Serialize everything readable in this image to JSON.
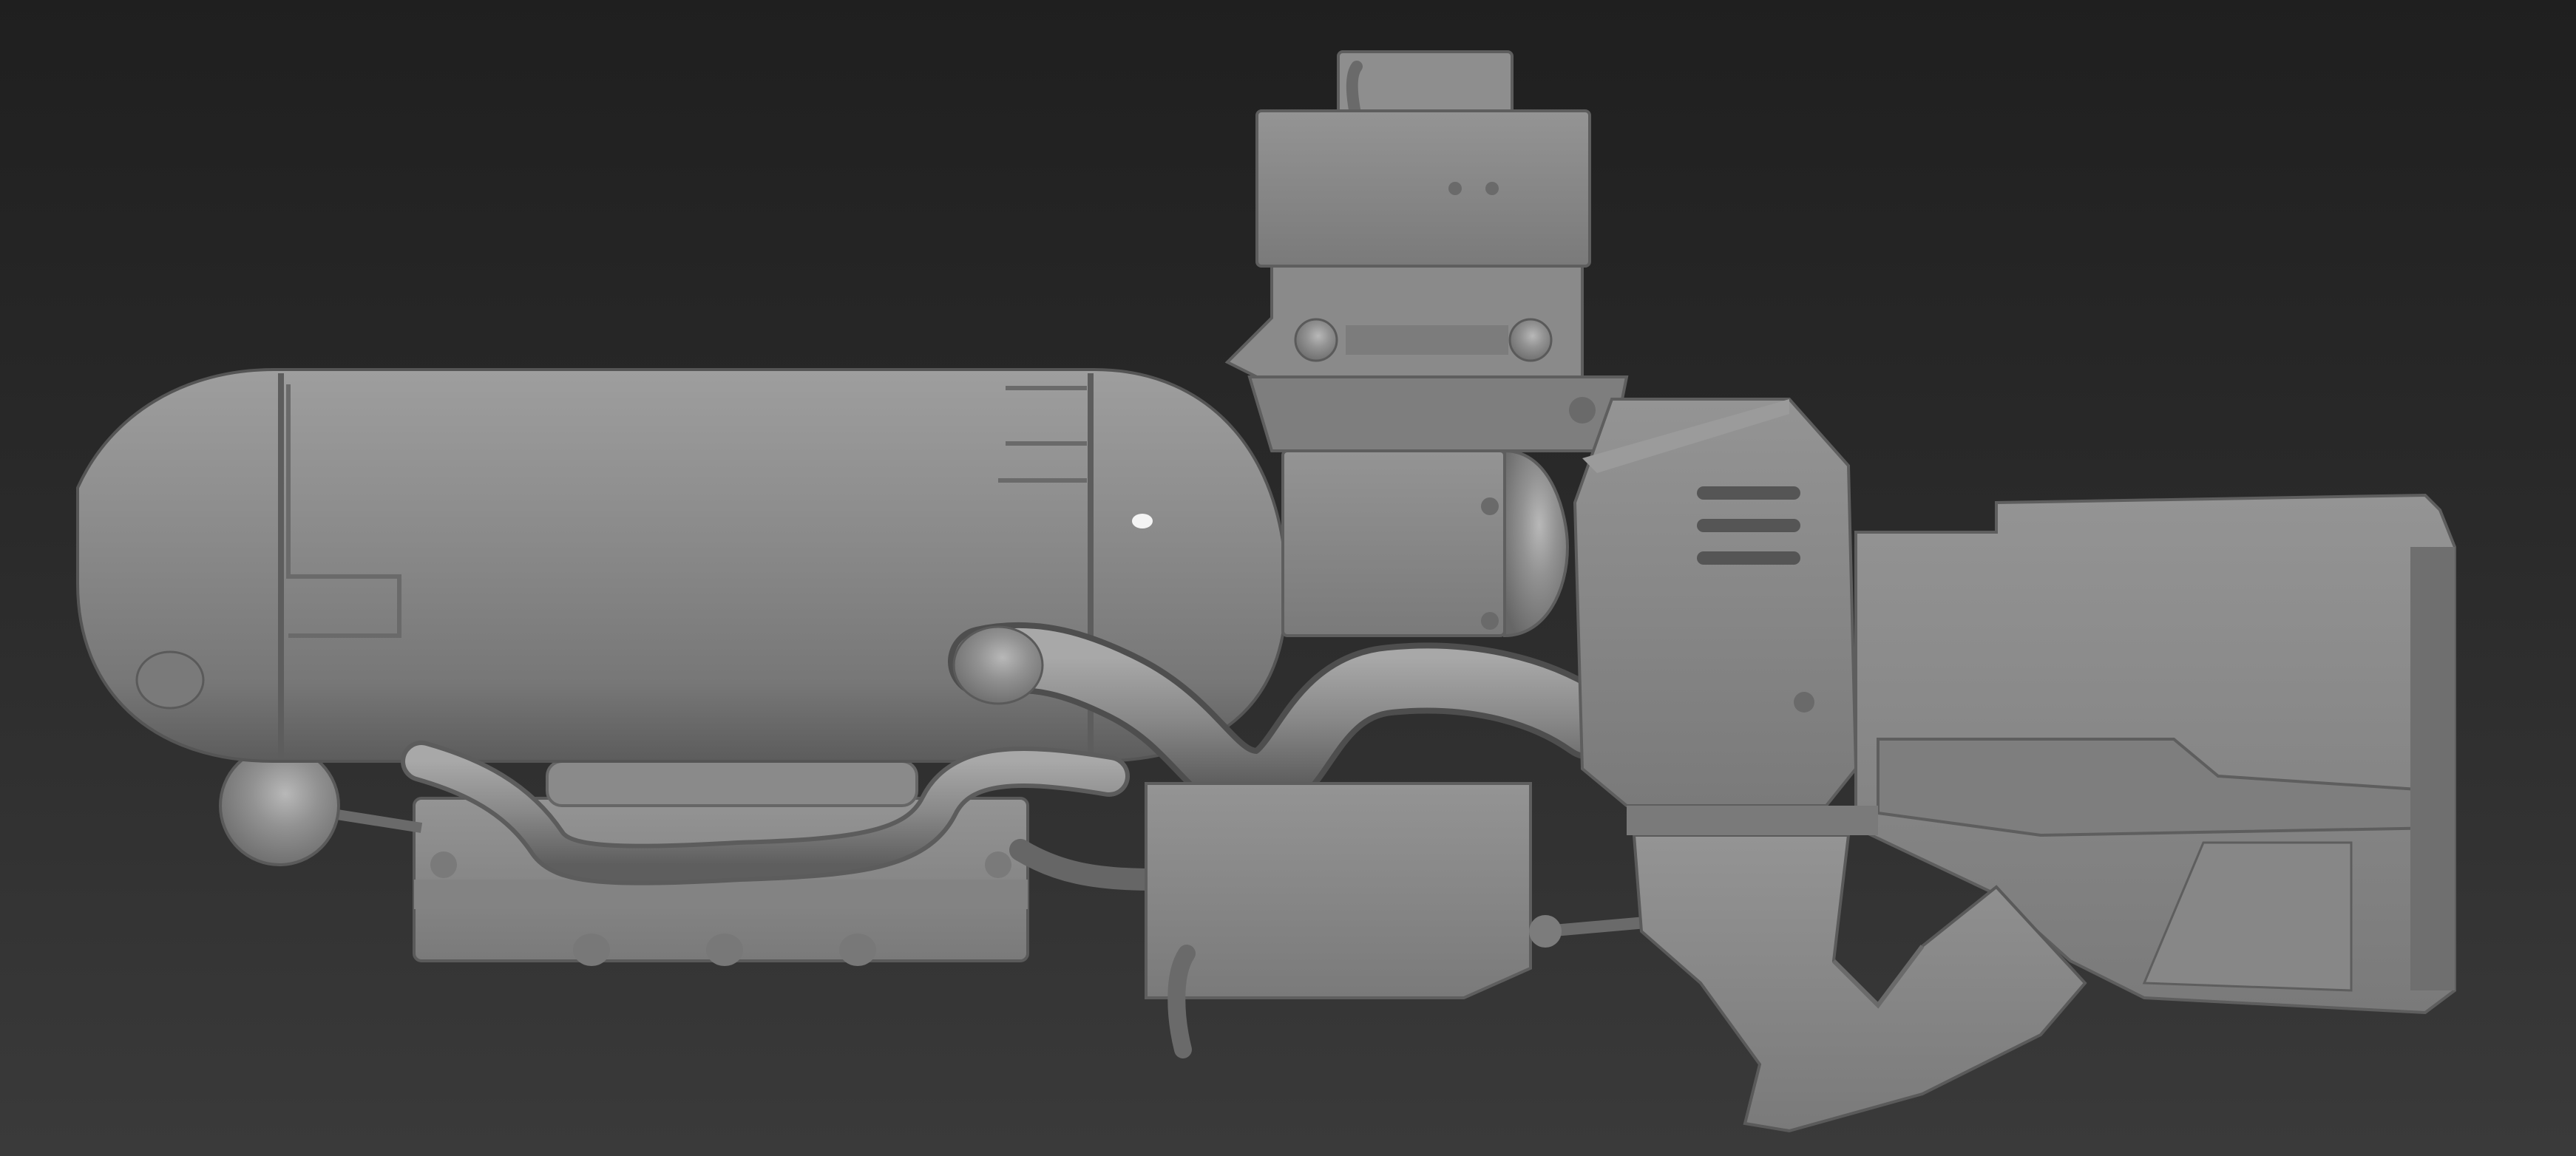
{
  "scene": {
    "subject": "weapon-3d-model",
    "view": "side",
    "shading": "clay-grey",
    "colors": {
      "background_top": "#1f1f1f",
      "background_bottom": "#3a3a3a",
      "model_base": "#8c8c8c",
      "model_light": "#a6a6a6",
      "model_dark": "#6a6a6a"
    }
  }
}
